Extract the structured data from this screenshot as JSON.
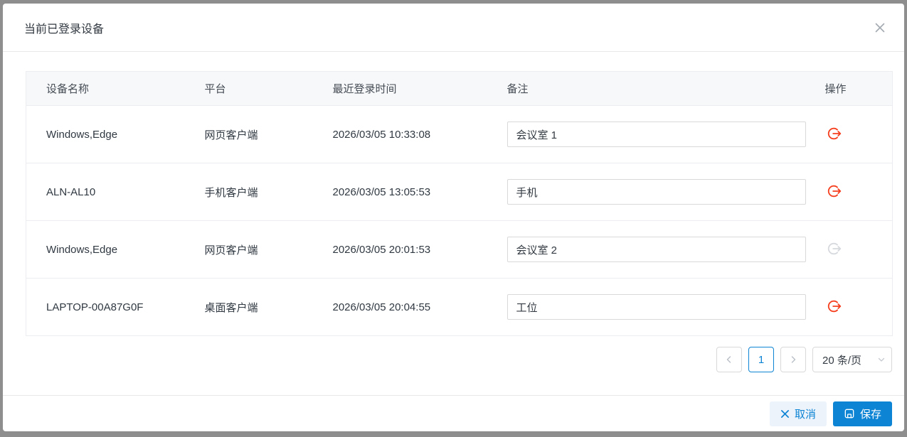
{
  "modal": {
    "title": "当前已登录设备"
  },
  "table": {
    "headers": [
      "设备名称",
      "平台",
      "最近登录时间",
      "备注",
      "操作"
    ],
    "rows": [
      {
        "device": "Windows,Edge",
        "platform": "网页客户端",
        "last_login": "2026/03/05 10:33:08",
        "remark": "会议室 1",
        "logout_enabled": true
      },
      {
        "device": "ALN-AL10",
        "platform": "手机客户端",
        "last_login": "2026/03/05 13:05:53",
        "remark": "手机",
        "logout_enabled": true
      },
      {
        "device": "Windows,Edge",
        "platform": "网页客户端",
        "last_login": "2026/03/05 20:01:53",
        "remark": "会议室 2",
        "logout_enabled": false
      },
      {
        "device": "LAPTOP-00A87G0F",
        "platform": "桌面客户端",
        "last_login": "2026/03/05 20:04:55",
        "remark": "工位",
        "logout_enabled": true
      }
    ]
  },
  "pagination": {
    "current_page": "1",
    "page_size": "20 条/页"
  },
  "footer": {
    "cancel_label": "取消",
    "save_label": "保存"
  },
  "colors": {
    "accent_blue": "#0d84d4",
    "danger_red": "#f53f1f",
    "disabled_gray": "#d6d9dd",
    "header_bg": "#f7f8fa"
  }
}
